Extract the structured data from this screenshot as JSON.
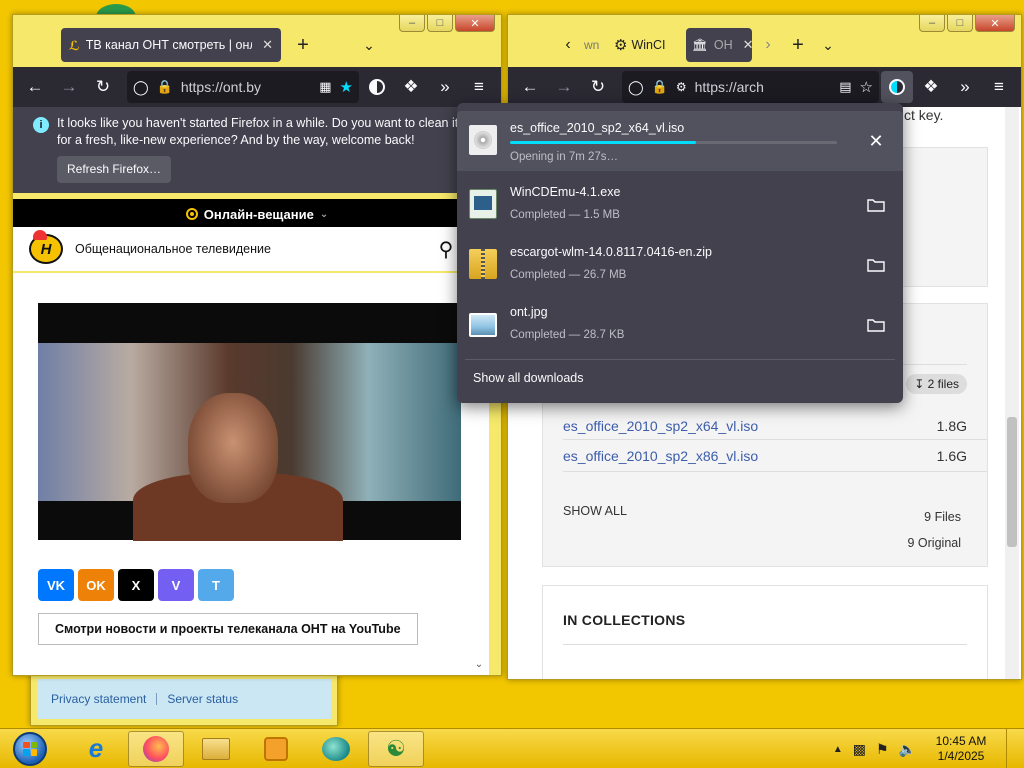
{
  "left_window": {
    "tab_title": "ТВ канал ОНТ смотреть | онлайн",
    "url": "https://ont.by",
    "notification": {
      "text": "It looks like you haven't started Firefox in a while. Do you want to clean it up for a fresh, like-new experience? And by the way, welcome back!",
      "button": "Refresh Firefox…"
    },
    "live_label": "Онлайн-вещание",
    "site_name": "Общенациональное телевидение",
    "logo_text": "Н",
    "social": [
      {
        "name": "vk",
        "label": "VK",
        "color": "#0077ff"
      },
      {
        "name": "ok",
        "label": "OK",
        "color": "#ee8208"
      },
      {
        "name": "x",
        "label": "X",
        "color": "#000000"
      },
      {
        "name": "viber",
        "label": "V",
        "color": "#7360f2"
      },
      {
        "name": "telegram",
        "label": "T",
        "color": "#54a9eb"
      }
    ],
    "youtube_button": "Смотри новости и проекты телеканала ОНТ на YouTube"
  },
  "background_window": {
    "links": [
      "Privacy statement",
      "Server status"
    ]
  },
  "right_window": {
    "tabs": [
      "wn",
      "WinCI",
      "ОН"
    ],
    "url": "https://arch",
    "partial_text": "ct key.",
    "files_badge": "2 files",
    "files": [
      {
        "name": "es_office_2010_sp2_x64_vl.iso",
        "size": "1.8G"
      },
      {
        "name": "es_office_2010_sp2_x86_vl.iso",
        "size": "1.6G"
      }
    ],
    "show_all": "SHOW ALL",
    "count_files": "9 Files",
    "count_original": "9 Original",
    "collections_heading": "IN COLLECTIONS"
  },
  "downloads": {
    "items": [
      {
        "name": "es_office_2010_sp2_x64_vl.iso",
        "status": "Opening in 7m 27s…",
        "progress": 0.57,
        "icon": "disc-icon",
        "action": "cancel"
      },
      {
        "name": "WinCDEmu-4.1.exe",
        "status": "Completed — 1.5 MB",
        "icon": "installer-icon",
        "action": "folder"
      },
      {
        "name": "escargot-wlm-14.0.8117.0416-en.zip",
        "status": "Completed — 26.7 MB",
        "icon": "zip-icon",
        "action": "folder"
      },
      {
        "name": "ont.jpg",
        "status": "Completed — 28.7 KB",
        "icon": "image-icon",
        "action": "folder"
      }
    ],
    "show_all": "Show all downloads"
  },
  "taskbar": {
    "time": "10:45 AM",
    "date": "1/4/2025"
  },
  "colors": {
    "desktop": "#f3c700",
    "firefox_dark": "#2b2a33",
    "panel": "#42414d",
    "progress": "#00ddff",
    "link": "#3d5dab"
  }
}
